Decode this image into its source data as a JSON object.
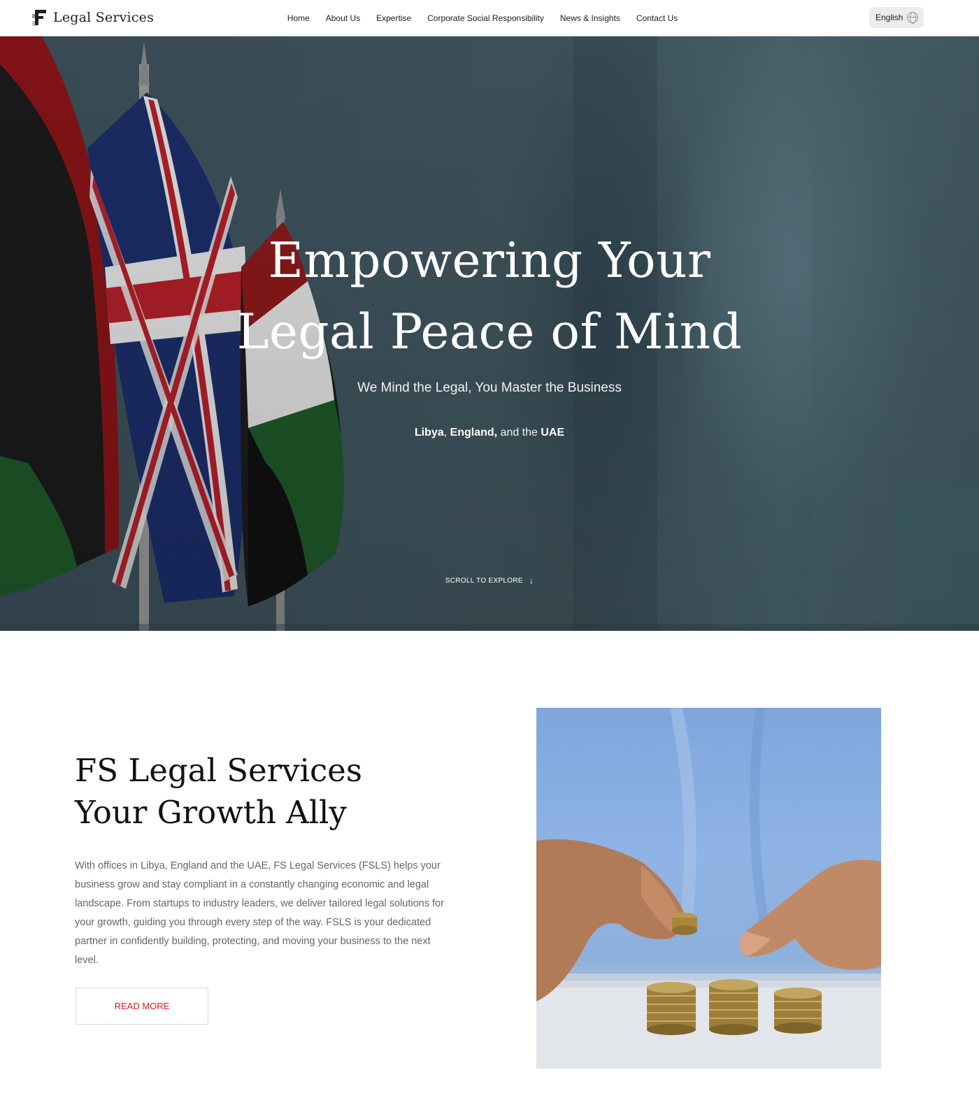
{
  "header": {
    "logo_text": "Legal Services",
    "nav": [
      "Home",
      "About Us",
      "Expertise",
      "Corporate Social Responsibility",
      "News & Insights",
      "Contact Us"
    ],
    "language": "English"
  },
  "hero": {
    "title_line1": "Empowering Your",
    "title_line2": "Legal Peace of Mind",
    "subtitle": "We Mind the Legal, You Master the Business",
    "locations": {
      "libya": "Libya",
      "sep1": ",",
      "england": "England,",
      "sep2": " and the ",
      "uae": "UAE"
    },
    "scroll_text": "SCROLL TO EXPLORE"
  },
  "about": {
    "title_line1": "FS Legal Services",
    "title_line2": "Your Growth Ally",
    "body": "With offices in Libya, England and the UAE, FS Legal Services (FSLS) helps your business grow and stay compliant in a constantly changing economic and legal landscape.  From startups to industry leaders, we deliver tailored legal solutions for your growth, guiding you through every step of the way. FSLS is your dedicated partner in confidently building, protecting, and moving your business to the next level.",
    "button": "READ MORE"
  },
  "colors": {
    "accent": "#d11f1f",
    "hero_overlay": "#3f5560",
    "text_dark": "#111111",
    "text_muted": "#666666"
  }
}
